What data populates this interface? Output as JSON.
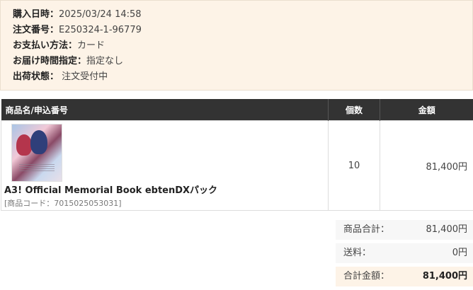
{
  "order_info": [
    {
      "label": "購入日時：",
      "value": "2025/03/24 14:58"
    },
    {
      "label": "注文番号：",
      "value": "E250324-1-96779"
    },
    {
      "label": "お支払い方法：",
      "value": "カード"
    },
    {
      "label": "お届け時間指定：",
      "value": "指定なし"
    },
    {
      "label": "出荷状態：",
      "value": " 注文受付中"
    }
  ],
  "table": {
    "headers": [
      "商品名/申込番号",
      "個数",
      "金額"
    ],
    "rows": [
      {
        "name": "A3! Official Memorial Book ebtenDXパック",
        "code": "[商品コード：7015025053031]",
        "qty": "10",
        "amount": "81,400円"
      }
    ]
  },
  "totals": [
    {
      "label": "商品合計：",
      "value": "81,400円"
    },
    {
      "label": "送料：",
      "value": "0円"
    },
    {
      "label": "合計金額：",
      "value": "81,400円"
    }
  ]
}
